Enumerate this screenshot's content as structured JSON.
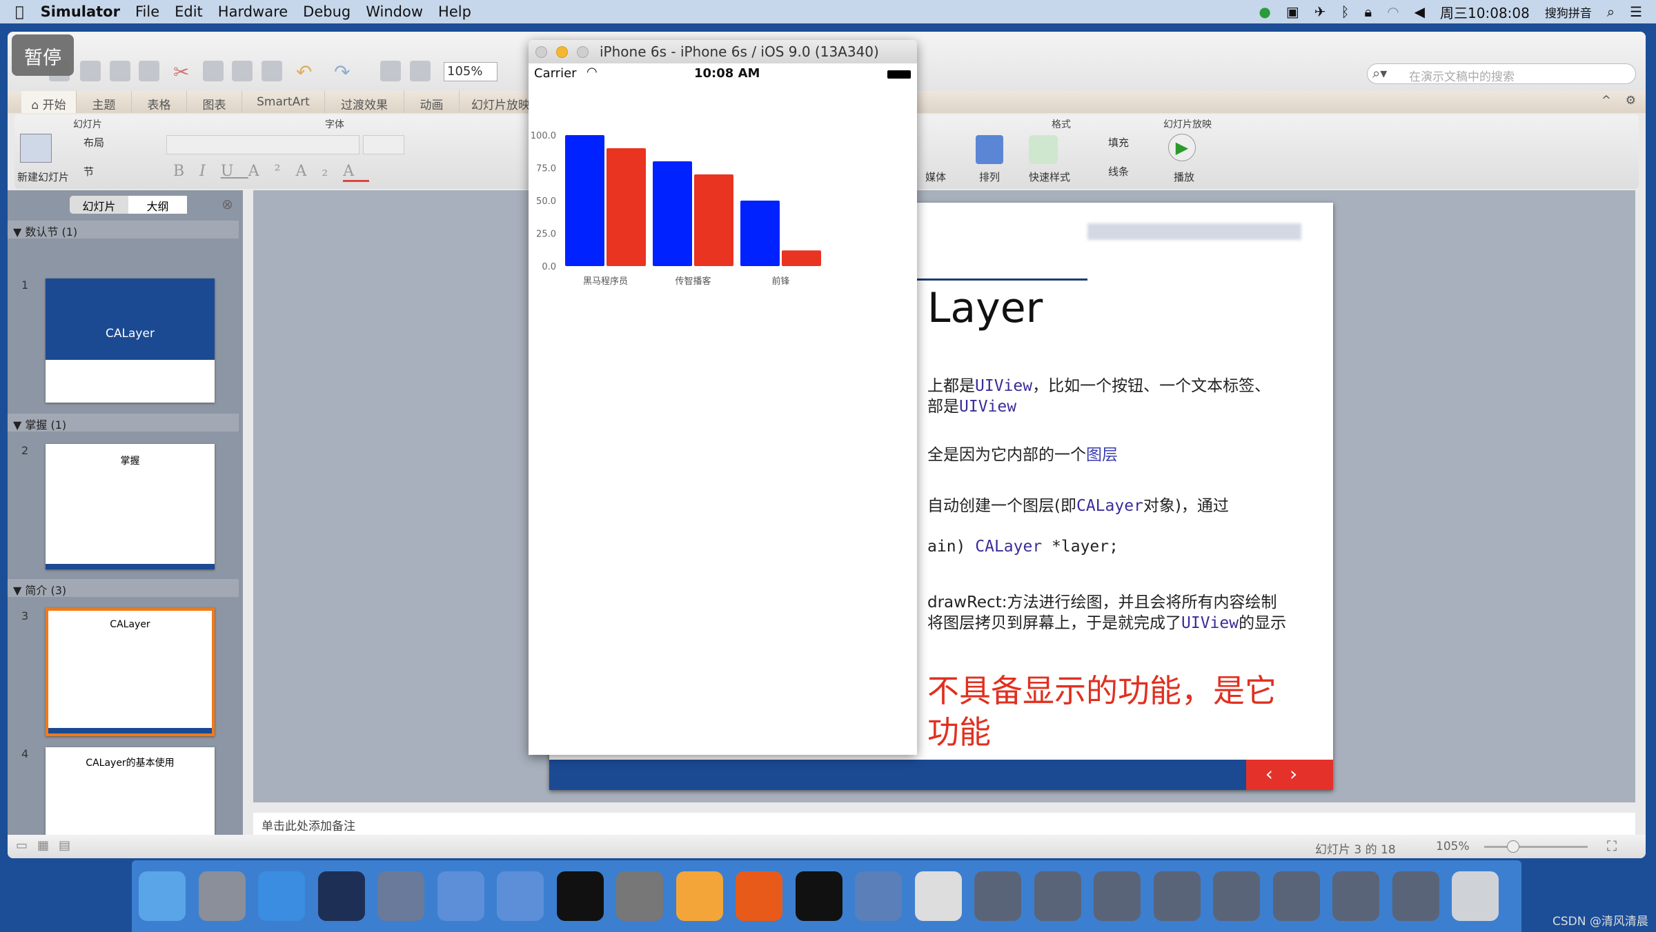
{
  "menubar": {
    "app": "Simulator",
    "items": [
      "File",
      "Edit",
      "Hardware",
      "Debug",
      "Window",
      "Help"
    ],
    "clock": "周三10:08:08",
    "ime": "搜狗拼音"
  },
  "overlay": {
    "pause": "暂停"
  },
  "ppt": {
    "zoom": "105%",
    "search_placeholder": "在演示文稿中的搜索",
    "tabs": [
      "开始",
      "主题",
      "表格",
      "图表",
      "SmartArt",
      "过渡效果",
      "动画",
      "幻灯片放映"
    ],
    "ribbon": {
      "group_slides": "幻灯片",
      "new_slide": "新建幻灯片",
      "layout": "布局",
      "section": "节",
      "group_font": "字体",
      "group_format": "格式",
      "media": "媒体",
      "arrange": "排列",
      "quick_styles": "快速样式",
      "fill": "填充",
      "line": "线条",
      "group_slideshow": "幻灯片放映",
      "play": "播放"
    },
    "pane_tabs": [
      "幻灯片",
      "大纲"
    ],
    "sections": [
      {
        "title": "数认节 (1)",
        "slides": [
          {
            "num": "1",
            "title": "CALayer"
          }
        ]
      },
      {
        "title": "掌握 (1)",
        "slides": [
          {
            "num": "2",
            "title": "掌握"
          }
        ]
      },
      {
        "title": "简介 (3)",
        "slides": [
          {
            "num": "3",
            "title": "CALayer"
          },
          {
            "num": "4",
            "title": "CALayer的基本使用"
          }
        ]
      }
    ],
    "slide": {
      "title": "Layer",
      "l1a": "上都是",
      "l1b": "UIView",
      "l1c": "，比如一个按钮、一个文本标签、",
      "l2a": "部是",
      "l2b": "UIView",
      "l3a": "全是因为它内部的一个",
      "l3b": "图层",
      "l4a": "自动创建一个图层(即",
      "l4b": "CALayer",
      "l4c": "对象)，通过",
      "l5a": "ain) ",
      "l5b": "CALayer",
      "l5c": " *layer;",
      "l6": "drawRect:方法进行绘图，并且会将所有内容绘制",
      "l7a": "将图层拷贝到屏幕上，于是就完成了",
      "l7b": "UIView",
      "l7c": "的显示",
      "red1": "不具备显示的功能，是它",
      "red2": "功能"
    },
    "notes_placeholder": "单击此处添加备注",
    "status": {
      "slide_count": "幻灯片 3 的 18",
      "zoom": "105%"
    }
  },
  "simulator": {
    "title": "iPhone 6s - iPhone 6s / iOS 9.0 (13A340)",
    "carrier": "Carrier",
    "time": "10:08 AM"
  },
  "chart_data": {
    "type": "bar",
    "categories": [
      "黑马程序员",
      "传智播客",
      "前锋"
    ],
    "series": [
      {
        "color": "#0022ff",
        "values": [
          100,
          80,
          50
        ]
      },
      {
        "color": "#e83420",
        "values": [
          90,
          70,
          12
        ]
      }
    ],
    "yticks": [
      "0.0",
      "25.0",
      "50.0",
      "75.0",
      "100.0"
    ],
    "ylim": [
      0,
      100
    ]
  },
  "dock": [
    "finder",
    "launchpad",
    "safari",
    "mouse",
    "photo-booth",
    "xcode",
    "instruments",
    "terminal",
    "system-preferences",
    "sketch",
    "powerpoint",
    "console",
    "quicktime",
    "preview",
    "screens",
    "trash"
  ],
  "watermark": "CSDN @清风清晨"
}
